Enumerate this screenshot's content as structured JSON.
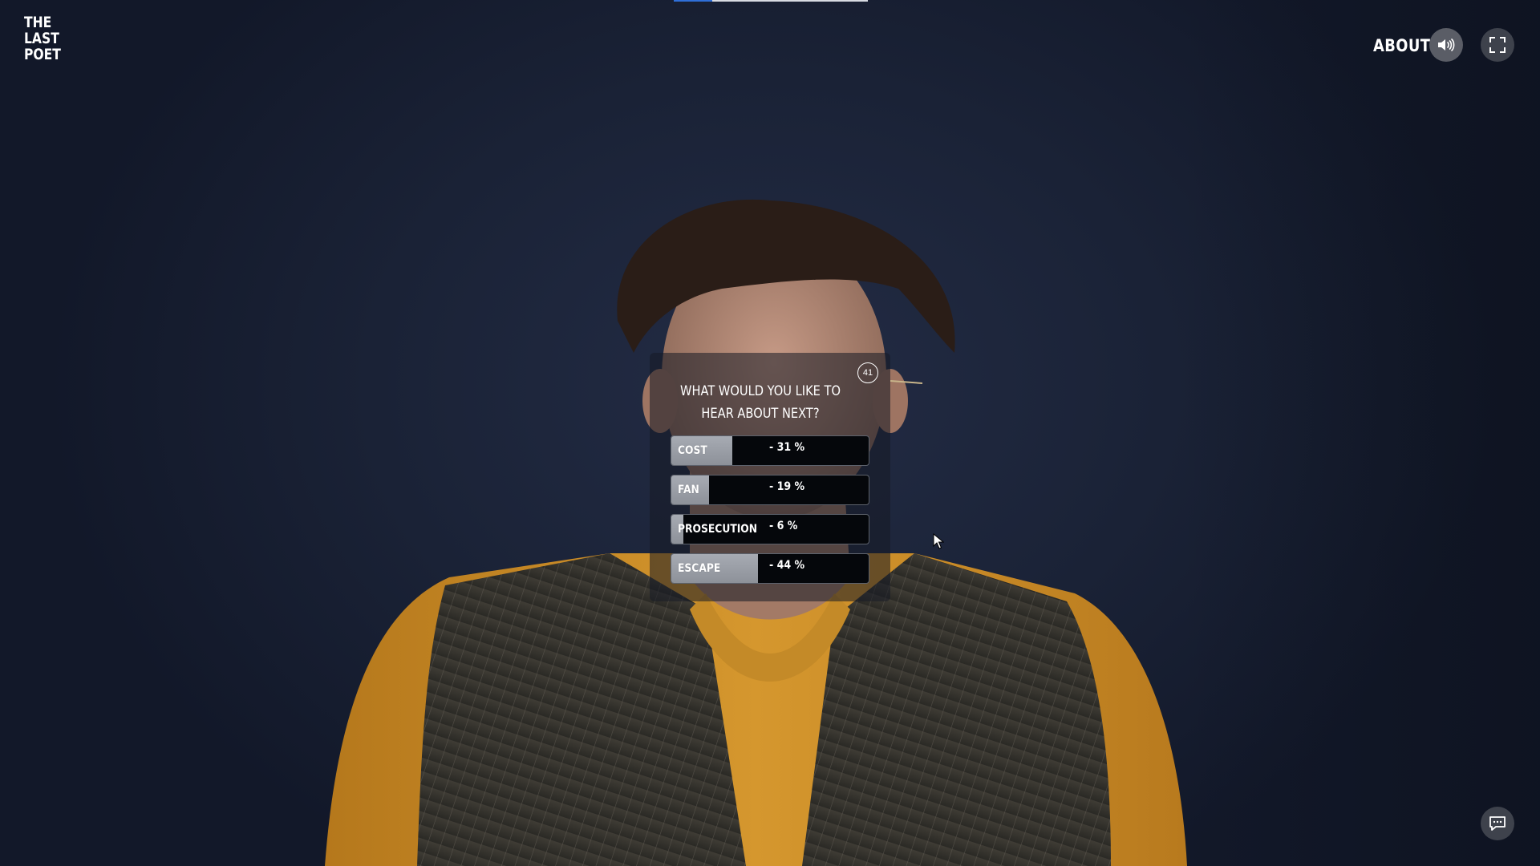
{
  "app": {
    "logo_lines": [
      "THE",
      "LAST",
      "POET"
    ]
  },
  "header": {
    "about_label": "ABOUT",
    "sound_icon": "speaker-volume-icon",
    "fullscreen_icon": "fullscreen-icon"
  },
  "playback": {
    "progress_fraction": 0.2
  },
  "poll": {
    "timer": "41",
    "question": "WHAT WOULD YOU LIKE TO HEAR ABOUT NEXT?",
    "options": [
      {
        "label": "COST",
        "percent_text": "- 31 %",
        "share": 0.31
      },
      {
        "label": "FAN",
        "percent_text": "- 19 %",
        "share": 0.19
      },
      {
        "label": "PROSECUTION",
        "percent_text": "- 6 %",
        "share": 0.06
      },
      {
        "label": "ESCAPE",
        "percent_text": "- 44 %",
        "share": 0.44
      }
    ]
  },
  "footer": {
    "chat_icon": "chat-bubble-icon"
  },
  "colors": {
    "background": "#1a2236",
    "accent_progress": "#2f6fd8",
    "option_fill": "#9a9ea6",
    "option_bg": "#05070b"
  }
}
